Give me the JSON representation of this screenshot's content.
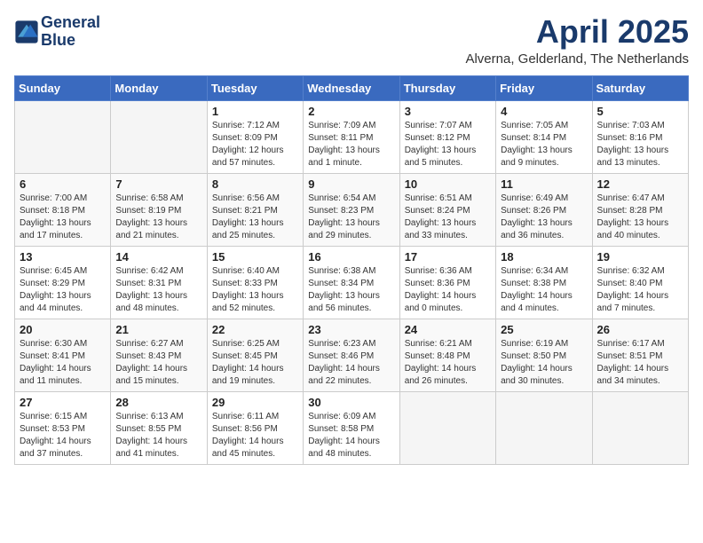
{
  "logo": {
    "line1": "General",
    "line2": "Blue"
  },
  "title": "April 2025",
  "location": "Alverna, Gelderland, The Netherlands",
  "weekdays": [
    "Sunday",
    "Monday",
    "Tuesday",
    "Wednesday",
    "Thursday",
    "Friday",
    "Saturday"
  ],
  "weeks": [
    [
      {
        "day": "",
        "sunrise": "",
        "sunset": "",
        "daylight": ""
      },
      {
        "day": "",
        "sunrise": "",
        "sunset": "",
        "daylight": ""
      },
      {
        "day": "1",
        "sunrise": "Sunrise: 7:12 AM",
        "sunset": "Sunset: 8:09 PM",
        "daylight": "Daylight: 12 hours and 57 minutes."
      },
      {
        "day": "2",
        "sunrise": "Sunrise: 7:09 AM",
        "sunset": "Sunset: 8:11 PM",
        "daylight": "Daylight: 13 hours and 1 minute."
      },
      {
        "day": "3",
        "sunrise": "Sunrise: 7:07 AM",
        "sunset": "Sunset: 8:12 PM",
        "daylight": "Daylight: 13 hours and 5 minutes."
      },
      {
        "day": "4",
        "sunrise": "Sunrise: 7:05 AM",
        "sunset": "Sunset: 8:14 PM",
        "daylight": "Daylight: 13 hours and 9 minutes."
      },
      {
        "day": "5",
        "sunrise": "Sunrise: 7:03 AM",
        "sunset": "Sunset: 8:16 PM",
        "daylight": "Daylight: 13 hours and 13 minutes."
      }
    ],
    [
      {
        "day": "6",
        "sunrise": "Sunrise: 7:00 AM",
        "sunset": "Sunset: 8:18 PM",
        "daylight": "Daylight: 13 hours and 17 minutes."
      },
      {
        "day": "7",
        "sunrise": "Sunrise: 6:58 AM",
        "sunset": "Sunset: 8:19 PM",
        "daylight": "Daylight: 13 hours and 21 minutes."
      },
      {
        "day": "8",
        "sunrise": "Sunrise: 6:56 AM",
        "sunset": "Sunset: 8:21 PM",
        "daylight": "Daylight: 13 hours and 25 minutes."
      },
      {
        "day": "9",
        "sunrise": "Sunrise: 6:54 AM",
        "sunset": "Sunset: 8:23 PM",
        "daylight": "Daylight: 13 hours and 29 minutes."
      },
      {
        "day": "10",
        "sunrise": "Sunrise: 6:51 AM",
        "sunset": "Sunset: 8:24 PM",
        "daylight": "Daylight: 13 hours and 33 minutes."
      },
      {
        "day": "11",
        "sunrise": "Sunrise: 6:49 AM",
        "sunset": "Sunset: 8:26 PM",
        "daylight": "Daylight: 13 hours and 36 minutes."
      },
      {
        "day": "12",
        "sunrise": "Sunrise: 6:47 AM",
        "sunset": "Sunset: 8:28 PM",
        "daylight": "Daylight: 13 hours and 40 minutes."
      }
    ],
    [
      {
        "day": "13",
        "sunrise": "Sunrise: 6:45 AM",
        "sunset": "Sunset: 8:29 PM",
        "daylight": "Daylight: 13 hours and 44 minutes."
      },
      {
        "day": "14",
        "sunrise": "Sunrise: 6:42 AM",
        "sunset": "Sunset: 8:31 PM",
        "daylight": "Daylight: 13 hours and 48 minutes."
      },
      {
        "day": "15",
        "sunrise": "Sunrise: 6:40 AM",
        "sunset": "Sunset: 8:33 PM",
        "daylight": "Daylight: 13 hours and 52 minutes."
      },
      {
        "day": "16",
        "sunrise": "Sunrise: 6:38 AM",
        "sunset": "Sunset: 8:34 PM",
        "daylight": "Daylight: 13 hours and 56 minutes."
      },
      {
        "day": "17",
        "sunrise": "Sunrise: 6:36 AM",
        "sunset": "Sunset: 8:36 PM",
        "daylight": "Daylight: 14 hours and 0 minutes."
      },
      {
        "day": "18",
        "sunrise": "Sunrise: 6:34 AM",
        "sunset": "Sunset: 8:38 PM",
        "daylight": "Daylight: 14 hours and 4 minutes."
      },
      {
        "day": "19",
        "sunrise": "Sunrise: 6:32 AM",
        "sunset": "Sunset: 8:40 PM",
        "daylight": "Daylight: 14 hours and 7 minutes."
      }
    ],
    [
      {
        "day": "20",
        "sunrise": "Sunrise: 6:30 AM",
        "sunset": "Sunset: 8:41 PM",
        "daylight": "Daylight: 14 hours and 11 minutes."
      },
      {
        "day": "21",
        "sunrise": "Sunrise: 6:27 AM",
        "sunset": "Sunset: 8:43 PM",
        "daylight": "Daylight: 14 hours and 15 minutes."
      },
      {
        "day": "22",
        "sunrise": "Sunrise: 6:25 AM",
        "sunset": "Sunset: 8:45 PM",
        "daylight": "Daylight: 14 hours and 19 minutes."
      },
      {
        "day": "23",
        "sunrise": "Sunrise: 6:23 AM",
        "sunset": "Sunset: 8:46 PM",
        "daylight": "Daylight: 14 hours and 22 minutes."
      },
      {
        "day": "24",
        "sunrise": "Sunrise: 6:21 AM",
        "sunset": "Sunset: 8:48 PM",
        "daylight": "Daylight: 14 hours and 26 minutes."
      },
      {
        "day": "25",
        "sunrise": "Sunrise: 6:19 AM",
        "sunset": "Sunset: 8:50 PM",
        "daylight": "Daylight: 14 hours and 30 minutes."
      },
      {
        "day": "26",
        "sunrise": "Sunrise: 6:17 AM",
        "sunset": "Sunset: 8:51 PM",
        "daylight": "Daylight: 14 hours and 34 minutes."
      }
    ],
    [
      {
        "day": "27",
        "sunrise": "Sunrise: 6:15 AM",
        "sunset": "Sunset: 8:53 PM",
        "daylight": "Daylight: 14 hours and 37 minutes."
      },
      {
        "day": "28",
        "sunrise": "Sunrise: 6:13 AM",
        "sunset": "Sunset: 8:55 PM",
        "daylight": "Daylight: 14 hours and 41 minutes."
      },
      {
        "day": "29",
        "sunrise": "Sunrise: 6:11 AM",
        "sunset": "Sunset: 8:56 PM",
        "daylight": "Daylight: 14 hours and 45 minutes."
      },
      {
        "day": "30",
        "sunrise": "Sunrise: 6:09 AM",
        "sunset": "Sunset: 8:58 PM",
        "daylight": "Daylight: 14 hours and 48 minutes."
      },
      {
        "day": "",
        "sunrise": "",
        "sunset": "",
        "daylight": ""
      },
      {
        "day": "",
        "sunrise": "",
        "sunset": "",
        "daylight": ""
      },
      {
        "day": "",
        "sunrise": "",
        "sunset": "",
        "daylight": ""
      }
    ]
  ]
}
